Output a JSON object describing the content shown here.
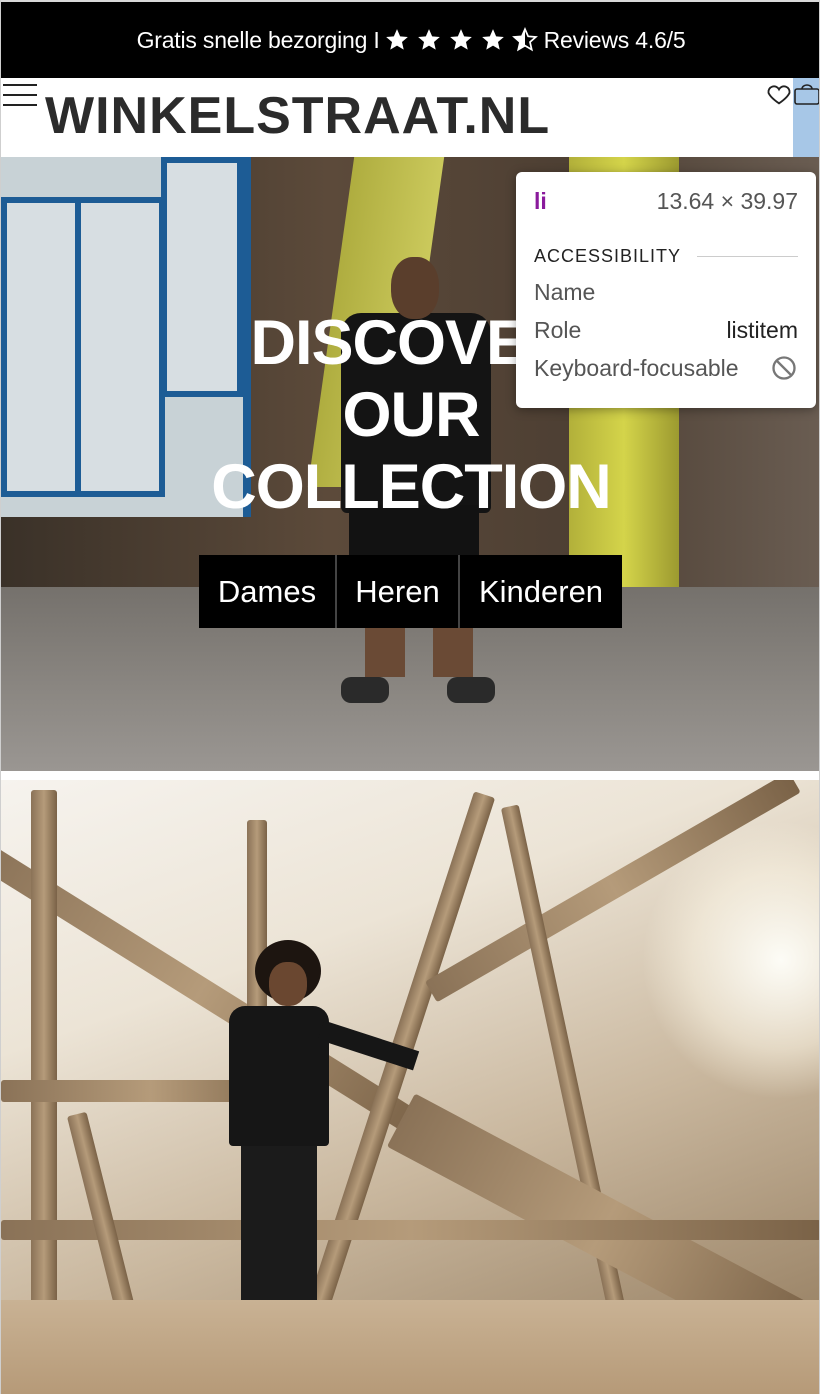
{
  "announcement": {
    "text_before": "Gratis snelle bezorging I",
    "text_after": "Reviews 4.6/5",
    "rating": 4.6,
    "rating_max": 5,
    "star_color": "#ffffff"
  },
  "header": {
    "logo": "WINKELSTRAAT.NL",
    "icons": [
      "menu-icon",
      "heart-icon",
      "bag-icon"
    ],
    "highlight_color": "#a7c7e7"
  },
  "hero": {
    "title_lines": [
      "DISCOVER",
      "OUR",
      "COLLECTION"
    ],
    "categories": [
      {
        "label": "Dames"
      },
      {
        "label": "Heren"
      },
      {
        "label": "Kinderen"
      }
    ]
  },
  "inspector": {
    "tag": "li",
    "size": "13.64 × 39.97",
    "section": "ACCESSIBILITY",
    "rows": [
      {
        "key": "Name",
        "value": ""
      },
      {
        "key": "Role",
        "value": "listitem"
      },
      {
        "key": "Keyboard-focusable",
        "value": "",
        "icon": "not-allowed-icon"
      }
    ],
    "tag_color": "#8a1a9c"
  }
}
